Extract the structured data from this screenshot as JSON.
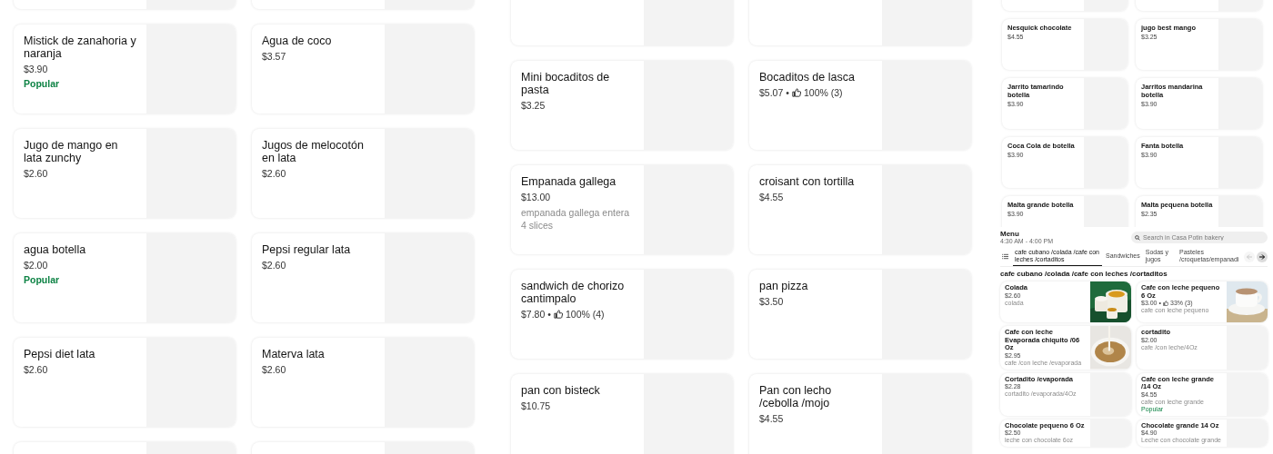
{
  "panels": [
    {
      "items": [
        {
          "kind": "blank"
        },
        {
          "kind": "blank"
        },
        {
          "kind": "item",
          "name": "Mistick de zanahoria y naranja",
          "price": "$3.90",
          "badge": "Popular"
        },
        {
          "kind": "item",
          "name": "Agua de coco",
          "price": "$3.57"
        },
        {
          "kind": "item",
          "name": "Jugo de mango en lata zunchy",
          "price": "$2.60"
        },
        {
          "kind": "item",
          "name": "Jugos de melocotón en lata",
          "price": "$2.60"
        },
        {
          "kind": "item",
          "name": "agua botella",
          "price": "$2.00",
          "badge": "Popular"
        },
        {
          "kind": "item",
          "name": "Pepsi regular lata",
          "price": "$2.60"
        },
        {
          "kind": "item",
          "name": "Pepsi diet lata",
          "price": "$2.60"
        },
        {
          "kind": "item",
          "name": "Materva lata",
          "price": "$2.60"
        },
        {
          "kind": "blank"
        },
        {
          "kind": "blank"
        }
      ]
    },
    {
      "items": [
        {
          "kind": "blank"
        },
        {
          "kind": "blank"
        },
        {
          "kind": "item",
          "name": "Mini bocaditos de pasta",
          "price": "$3.25"
        },
        {
          "kind": "item",
          "name": "Bocaditos de lasca",
          "price": "$5.07",
          "dot": "•",
          "rating": "100% (3)"
        },
        {
          "kind": "item",
          "name": "Empanada gallega",
          "price": "$13.00",
          "description": "empanada gallega entera 4 slices"
        },
        {
          "kind": "item",
          "name": "croisant con tortilla",
          "price": "$4.55"
        },
        {
          "kind": "item",
          "name": "sandwich de chorizo cantimpalo",
          "price": "$7.80",
          "dot": "•",
          "rating": "100% (4)"
        },
        {
          "kind": "item",
          "name": "pan pizza",
          "price": "$3.50"
        },
        {
          "kind": "item",
          "name": "pan con bisteck",
          "price": "$10.75"
        },
        {
          "kind": "item",
          "name": "Pan con lecho /cebolla /mojo",
          "price": "$4.55"
        }
      ]
    },
    {
      "items": [
        {
          "kind": "blank"
        },
        {
          "kind": "blank"
        },
        {
          "kind": "item",
          "name": "Nesquick chocolate",
          "price": "$4.55"
        },
        {
          "kind": "item",
          "name": "jugo best mango",
          "price": "$3.25"
        },
        {
          "kind": "item",
          "name": "Jarrito tamarindo botella",
          "price": "$3.90"
        },
        {
          "kind": "item",
          "name": "Jarritos mandarina botella",
          "price": "$3.90"
        },
        {
          "kind": "item",
          "name": "Coca Cola de botella",
          "price": "$3.90"
        },
        {
          "kind": "item",
          "name": "Fanta botella",
          "price": "$3.90"
        },
        {
          "kind": "item",
          "name": "Malta grande botella",
          "price": "$3.90"
        },
        {
          "kind": "item",
          "name": "Malta pequena botella",
          "price": "$2.35"
        }
      ]
    }
  ],
  "menu": {
    "title": "Menu",
    "hours": "4:30 AM - 4:00 PM",
    "search": {
      "placeholder": "Search in Casa Potin bakery"
    },
    "tabs": [
      {
        "label": "cafe cubano /colada /cafe con leches /cortaditos",
        "selected": true
      },
      {
        "label": "Sandwiches",
        "selected": false
      },
      {
        "label": "Sodas y jugos",
        "selected": false
      },
      {
        "label": "Pasteles /croquetas/empanadi",
        "selected": false
      }
    ],
    "scroll_buttons": [
      {
        "kind": "left",
        "disabled": true
      },
      {
        "kind": "right",
        "disabled": false
      }
    ],
    "section_title": "cafe cubano /colada /cafe con leches /cortaditos",
    "items": [
      {
        "kind": "item",
        "name": "Colada",
        "price": "$2.60",
        "description": "colada",
        "photo": true
      },
      {
        "kind": "item",
        "name": "Cafe con leche pequeno 6 Oz",
        "price": "$3.00",
        "dot": "•",
        "rating": "33% (3)",
        "description": "cafe con leche pequeno",
        "photo": true
      },
      {
        "kind": "item",
        "name": "Cafe con leche Evaporada chiquito /06 Oz",
        "price": "$2.95",
        "description": "cafe /con leche /evaporada",
        "photo": true
      },
      {
        "kind": "item",
        "name": "cortadito",
        "price": "$2.00",
        "description": "cafe /con leche/4Oz"
      },
      {
        "kind": "item",
        "name": "Cortadito /evaporada",
        "price": "$2.28",
        "description": "cortadito /evaporada/4Oz"
      },
      {
        "kind": "item",
        "name": "Cafe con leche grande /14 Oz",
        "price": "$4.55",
        "description": "cafe con leche grande",
        "badge": "Popular"
      },
      {
        "kind": "item",
        "name": "Chocolate pequeno 6 Oz",
        "price": "$2.50",
        "description": "leche con chocolate 6oz"
      },
      {
        "kind": "item",
        "name": "Chocolate grande 14 Oz",
        "price": "$4.90",
        "description": "Leche con chocolate grande"
      }
    ]
  }
}
